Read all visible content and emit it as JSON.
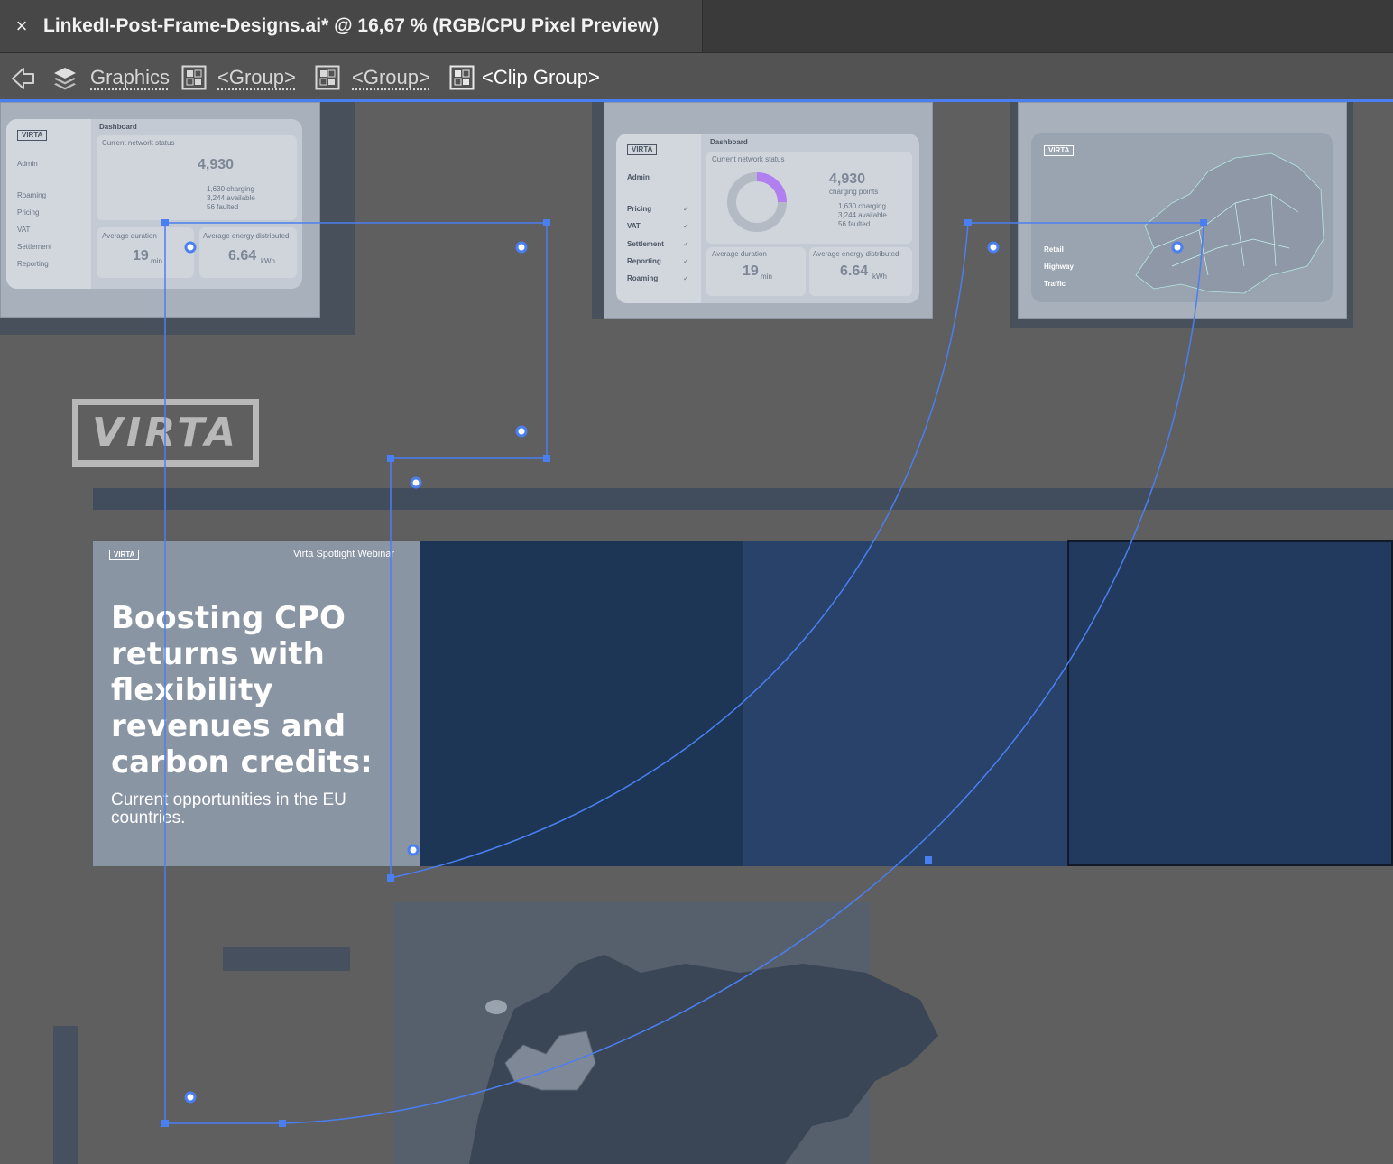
{
  "window": {
    "tab_close": "×",
    "tab_title": "LinkedI-Post-Frame-Designs.ai* @ 16,67 % (RGB/CPU Pixel Preview)"
  },
  "breadcrumb": {
    "items": [
      {
        "label": "Graphics",
        "icon": "layers-icon"
      },
      {
        "label": "<Group>",
        "icon": "group-icon"
      },
      {
        "label": "<Group>",
        "icon": "group-icon"
      },
      {
        "label": "<Clip Group>",
        "icon": "group-icon"
      }
    ]
  },
  "artboard": {
    "dashboard_left": {
      "title": "Dashboard",
      "subtitle": "Current network status",
      "menu": [
        "Admin",
        "Roaming",
        "Pricing",
        "VAT",
        "Settlement",
        "Reporting"
      ],
      "total": "4,930",
      "legend": [
        "1,630 charging",
        "3,244 available",
        "56 faulted"
      ],
      "avg_duration_label": "Average duration",
      "avg_duration": "19",
      "avg_duration_unit": "min",
      "avg_energy_label": "Average energy distributed",
      "avg_energy": "6.64",
      "avg_energy_unit": "kWh"
    },
    "dashboard_mid": {
      "title": "Dashboard",
      "subtitle": "Current network status",
      "menu": [
        "Admin",
        "Pricing",
        "VAT",
        "Settlement",
        "Reporting",
        "Roaming"
      ],
      "total": "4,930",
      "total_caption": "charging points",
      "legend": [
        "1,630 charging",
        "3,244 available",
        "56 faulted"
      ],
      "avg_duration_label": "Average duration",
      "avg_duration": "19",
      "avg_duration_unit": "min",
      "avg_energy_label": "Average energy distributed",
      "avg_energy": "6.64",
      "avg_energy_unit": "kWh"
    },
    "dashboard_map": {
      "legend": [
        "Retail",
        "Highway",
        "Traffic"
      ]
    },
    "logo_text": "VIRTA",
    "banner": {
      "webinar_label": "Virta Spotlight Webinar",
      "headline": "Boosting CPO returns with flexibility revenues and carbon credits:",
      "subline": "Current opportunities in the EU countries."
    }
  },
  "colors": {
    "selection": "#4a7ff2",
    "canvas": "#5f5f5f",
    "navy": "#1e3656",
    "card": "#a8b0bc"
  }
}
